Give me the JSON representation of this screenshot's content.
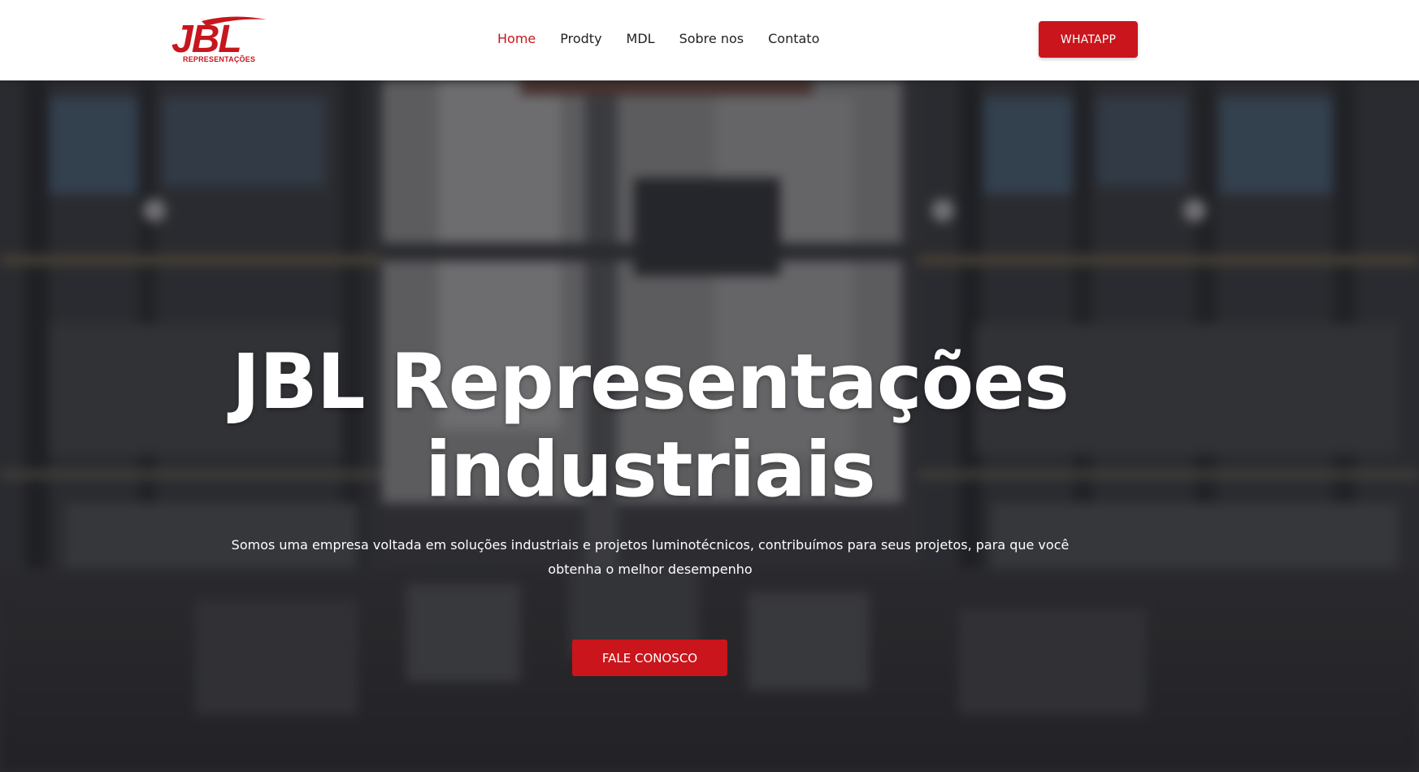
{
  "brand": {
    "logo_text": "JBL",
    "logo_subtext": "REPRESENTAÇÕES",
    "brand_color": "#c7161d"
  },
  "nav": {
    "items": [
      {
        "label": "Home",
        "active": true
      },
      {
        "label": "Prodty",
        "active": false
      },
      {
        "label": "MDL",
        "active": false
      },
      {
        "label": "Sobre nos",
        "active": false
      },
      {
        "label": "Contato",
        "active": false
      }
    ],
    "active_color": "#c7161d"
  },
  "header": {
    "whatsapp_label": "WHATAPP"
  },
  "hero": {
    "title_line1": "JBL Representações",
    "title_line2": "industriais",
    "subtitle": "Somos uma empresa voltada em soluções industriais e projetos luminotécnicos, contribuímos para seus projetos, para que você obtenha o melhor desempenho",
    "cta_label": "FALE CONOSCO",
    "background": "blurred industrial warehouse shelving photo",
    "button_color": "#c9151b"
  }
}
